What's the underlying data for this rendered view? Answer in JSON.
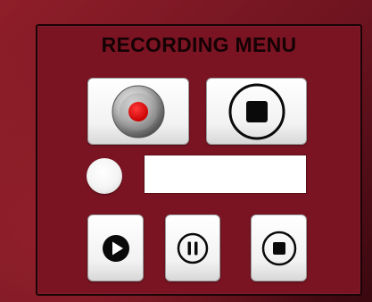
{
  "panel": {
    "title": "RECORDING MENU",
    "time_display": ""
  },
  "colors": {
    "panel_bg": "#7a1422",
    "record_dot": "#e00000",
    "button_face": "#f2f2f2",
    "icon_black": "#0a0a0a"
  },
  "icons": {
    "record": "record-icon",
    "stop_large": "stop-icon",
    "play": "play-icon",
    "pause": "pause-icon",
    "stop_small": "stop-icon"
  }
}
